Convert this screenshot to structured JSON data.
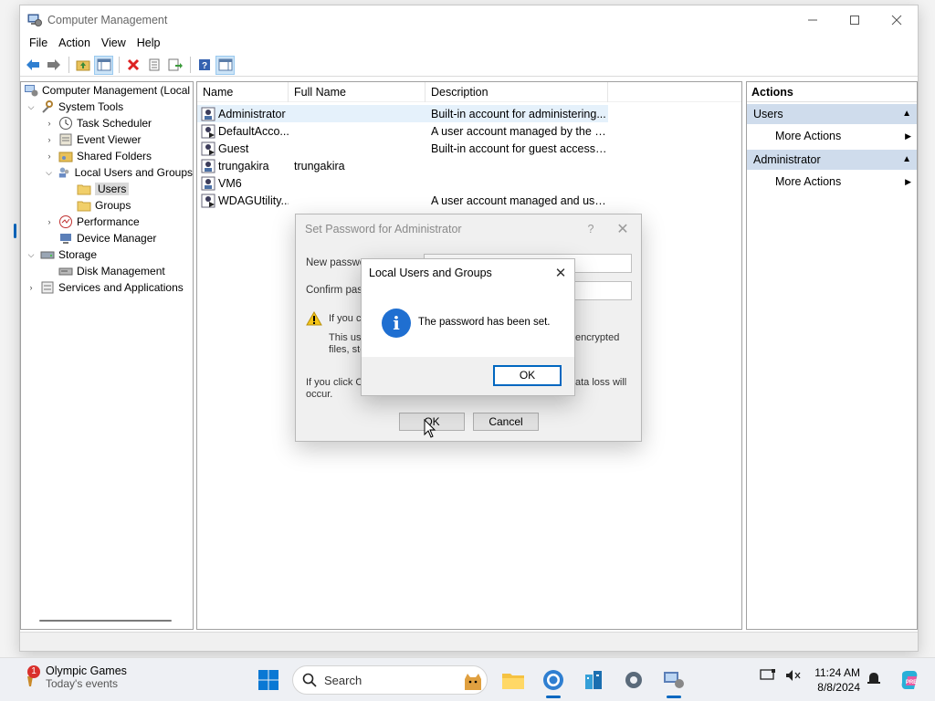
{
  "window": {
    "title": "Computer Management"
  },
  "menu": [
    "File",
    "Action",
    "View",
    "Help"
  ],
  "tree": {
    "root": "Computer Management (Local",
    "items": [
      {
        "label": "System Tools",
        "level": 1,
        "expander": "down"
      },
      {
        "label": "Task Scheduler",
        "level": 2,
        "expander": "right"
      },
      {
        "label": "Event Viewer",
        "level": 2,
        "expander": "right"
      },
      {
        "label": "Shared Folders",
        "level": 2,
        "expander": "right"
      },
      {
        "label": "Local Users and Groups",
        "level": 2,
        "expander": "down"
      },
      {
        "label": "Users",
        "level": 3,
        "expander": "",
        "selected": true
      },
      {
        "label": "Groups",
        "level": 3,
        "expander": ""
      },
      {
        "label": "Performance",
        "level": 2,
        "expander": "right"
      },
      {
        "label": "Device Manager",
        "level": 2,
        "expander": ""
      },
      {
        "label": "Storage",
        "level": 1,
        "expander": "down"
      },
      {
        "label": "Disk Management",
        "level": 2,
        "expander": ""
      },
      {
        "label": "Services and Applications",
        "level": 1,
        "expander": "right"
      }
    ]
  },
  "list": {
    "columns": [
      "Name",
      "Full Name",
      "Description"
    ],
    "rows": [
      {
        "name": "Administrator",
        "full": "",
        "desc": "Built-in account for administering...",
        "selected": true
      },
      {
        "name": "DefaultAcco...",
        "full": "",
        "desc": "A user account managed by the s..."
      },
      {
        "name": "Guest",
        "full": "",
        "desc": "Built-in account for guest access t..."
      },
      {
        "name": "trungakira",
        "full": "trungakira",
        "desc": ""
      },
      {
        "name": "VM6",
        "full": "",
        "desc": ""
      },
      {
        "name": "WDAGUtility...",
        "full": "",
        "desc": "A user account managed and use..."
      }
    ]
  },
  "actions": {
    "header": "Actions",
    "groups": [
      {
        "title": "Users",
        "item": "More Actions"
      },
      {
        "title": "Administrator",
        "item": "More Actions"
      }
    ]
  },
  "set_password_dialog": {
    "title": "Set Password for Administrator",
    "help": "?",
    "new_password_label": "New passwo",
    "confirm_password_label": "Confirm pass",
    "warning_line1": "If you cl",
    "warning_line2": "This use",
    "warning_line2_right": "encrypted",
    "warning_line3": "files, sto",
    "bottom_left_1": "If you click C",
    "bottom_right_1": "ata loss will",
    "bottom_left_2": "occur.",
    "ok_label": "OK",
    "cancel_label": "Cancel"
  },
  "info_dialog": {
    "title": "Local Users and Groups",
    "message": "The password has been set.",
    "ok_label": "OK",
    "icon": "i"
  },
  "taskbar": {
    "weather_title": "Olympic Games",
    "weather_sub": "Today's events",
    "weather_badge": "1",
    "search_placeholder": "Search",
    "time": "11:24 AM",
    "date": "8/8/2024"
  },
  "colors": {
    "accent": "#0067c0",
    "selection": "#e5f1fb",
    "actions_group": "#cfdcec",
    "info_icon": "#1f6fd1"
  }
}
